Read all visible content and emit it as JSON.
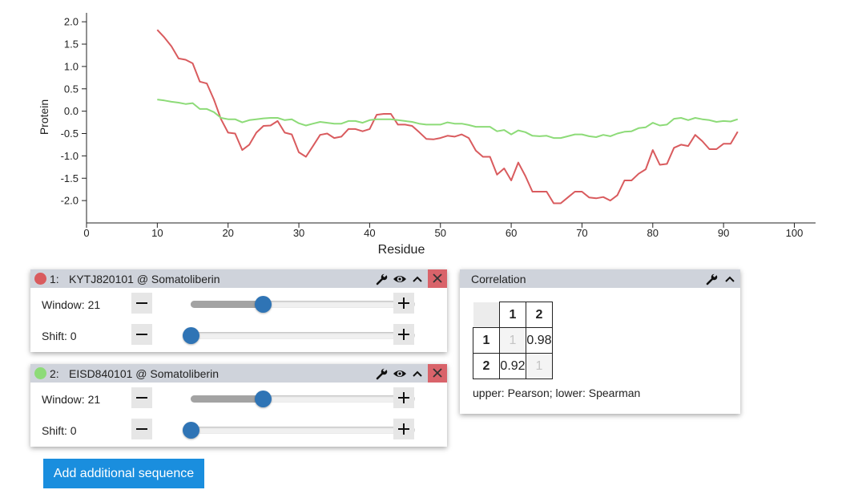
{
  "chart_data": {
    "type": "line",
    "xlabel": "Residue",
    "ylabel": "Protein",
    "xlim": [
      0,
      103
    ],
    "ylim": [
      -2.5,
      2.2
    ],
    "xticks": [
      0,
      10,
      20,
      30,
      40,
      50,
      60,
      70,
      80,
      90,
      100
    ],
    "yticks": [
      2.0,
      1.5,
      1.0,
      0.5,
      0.0,
      -0.5,
      -1.0,
      -1.5,
      -2.0
    ],
    "grid": false,
    "series": [
      {
        "index": 1,
        "color": "#d95b5e",
        "x": [
          10,
          11,
          12,
          13,
          14,
          15,
          16,
          17,
          18,
          19,
          20,
          21,
          22,
          23,
          24,
          25,
          26,
          27,
          28,
          29,
          30,
          31,
          32,
          33,
          34,
          35,
          36,
          37,
          38,
          39,
          40,
          41,
          42,
          43,
          44,
          45,
          46,
          47,
          48,
          49,
          50,
          51,
          52,
          53,
          54,
          55,
          56,
          57,
          58,
          59,
          60,
          61,
          62,
          63,
          64,
          65,
          66,
          67,
          68,
          69,
          70,
          71,
          72,
          73,
          74,
          75,
          76,
          77,
          78,
          79,
          80,
          81,
          82,
          83,
          84,
          85,
          86,
          87,
          88,
          89,
          90,
          91,
          92
        ],
        "y": [
          1.82,
          1.65,
          1.45,
          1.18,
          1.15,
          1.07,
          0.66,
          0.62,
          0.26,
          -0.18,
          -0.48,
          -0.5,
          -0.87,
          -0.75,
          -0.48,
          -0.33,
          -0.32,
          -0.22,
          -0.48,
          -0.52,
          -0.92,
          -1.02,
          -0.78,
          -0.53,
          -0.5,
          -0.6,
          -0.57,
          -0.4,
          -0.4,
          -0.45,
          -0.4,
          -0.08,
          -0.06,
          -0.06,
          -0.3,
          -0.3,
          -0.33,
          -0.47,
          -0.62,
          -0.63,
          -0.6,
          -0.55,
          -0.57,
          -0.52,
          -0.6,
          -0.88,
          -1.02,
          -1.02,
          -1.42,
          -1.28,
          -1.55,
          -1.15,
          -1.45,
          -1.8,
          -1.8,
          -1.8,
          -2.06,
          -2.06,
          -1.93,
          -1.8,
          -1.8,
          -1.93,
          -1.95,
          -1.92,
          -2.0,
          -1.88,
          -1.55,
          -1.55,
          -1.4,
          -1.3,
          -0.87,
          -1.2,
          -1.18,
          -0.82,
          -0.75,
          -0.78,
          -0.53,
          -0.67,
          -0.85,
          -0.85,
          -0.73,
          -0.73,
          -0.46
        ]
      },
      {
        "index": 2,
        "color": "#8ddb78",
        "x": [
          10,
          11,
          12,
          13,
          14,
          15,
          16,
          17,
          18,
          19,
          20,
          21,
          22,
          23,
          24,
          25,
          26,
          27,
          28,
          29,
          30,
          31,
          32,
          33,
          34,
          35,
          36,
          37,
          38,
          39,
          40,
          41,
          42,
          43,
          44,
          45,
          46,
          47,
          48,
          49,
          50,
          51,
          52,
          53,
          54,
          55,
          56,
          57,
          58,
          59,
          60,
          61,
          62,
          63,
          64,
          65,
          66,
          67,
          68,
          69,
          70,
          71,
          72,
          73,
          74,
          75,
          76,
          77,
          78,
          79,
          80,
          81,
          82,
          83,
          84,
          85,
          86,
          87,
          88,
          89,
          90,
          91,
          92
        ],
        "y": [
          0.26,
          0.24,
          0.21,
          0.19,
          0.16,
          0.18,
          0.05,
          0.05,
          -0.02,
          -0.15,
          -0.18,
          -0.18,
          -0.25,
          -0.2,
          -0.18,
          -0.16,
          -0.15,
          -0.15,
          -0.2,
          -0.18,
          -0.27,
          -0.32,
          -0.28,
          -0.24,
          -0.26,
          -0.28,
          -0.28,
          -0.22,
          -0.22,
          -0.26,
          -0.2,
          -0.18,
          -0.18,
          -0.18,
          -0.2,
          -0.22,
          -0.24,
          -0.28,
          -0.3,
          -0.3,
          -0.3,
          -0.25,
          -0.28,
          -0.28,
          -0.31,
          -0.35,
          -0.35,
          -0.35,
          -0.45,
          -0.42,
          -0.52,
          -0.43,
          -0.47,
          -0.55,
          -0.56,
          -0.55,
          -0.6,
          -0.6,
          -0.56,
          -0.52,
          -0.52,
          -0.56,
          -0.58,
          -0.53,
          -0.56,
          -0.5,
          -0.46,
          -0.45,
          -0.38,
          -0.36,
          -0.26,
          -0.32,
          -0.3,
          -0.17,
          -0.15,
          -0.2,
          -0.15,
          -0.18,
          -0.2,
          -0.24,
          -0.22,
          -0.23,
          -0.18
        ]
      }
    ]
  },
  "sequences": [
    {
      "index_label": "1:",
      "title": "KYTJ820101 @ Somatoliberin",
      "color": "#d95b5e",
      "window_label": "Window: 21",
      "window_level": 0.32,
      "shift_label": "Shift: 0",
      "shift_level": 0.0
    },
    {
      "index_label": "2:",
      "title": "EISD840101 @ Somatoliberin",
      "color": "#8ddb78",
      "window_label": "Window: 21",
      "window_level": 0.32,
      "shift_label": "Shift: 0",
      "shift_level": 0.0
    }
  ],
  "add_button_label": "Add additional sequence",
  "correlation": {
    "title": "Correlation",
    "headers": [
      "1",
      "2"
    ],
    "rows": [
      {
        "label": "1",
        "cells": [
          "1",
          "0.98"
        ]
      },
      {
        "label": "2",
        "cells": [
          "0.92",
          "1"
        ]
      }
    ],
    "note": "upper: Pearson; lower: Spearman"
  },
  "icons": {
    "settings": "wrench-icon",
    "visibility": "eye-icon",
    "collapse": "chevron-up-icon",
    "close": "close-icon",
    "decrement": "minus-icon",
    "increment": "plus-icon"
  }
}
